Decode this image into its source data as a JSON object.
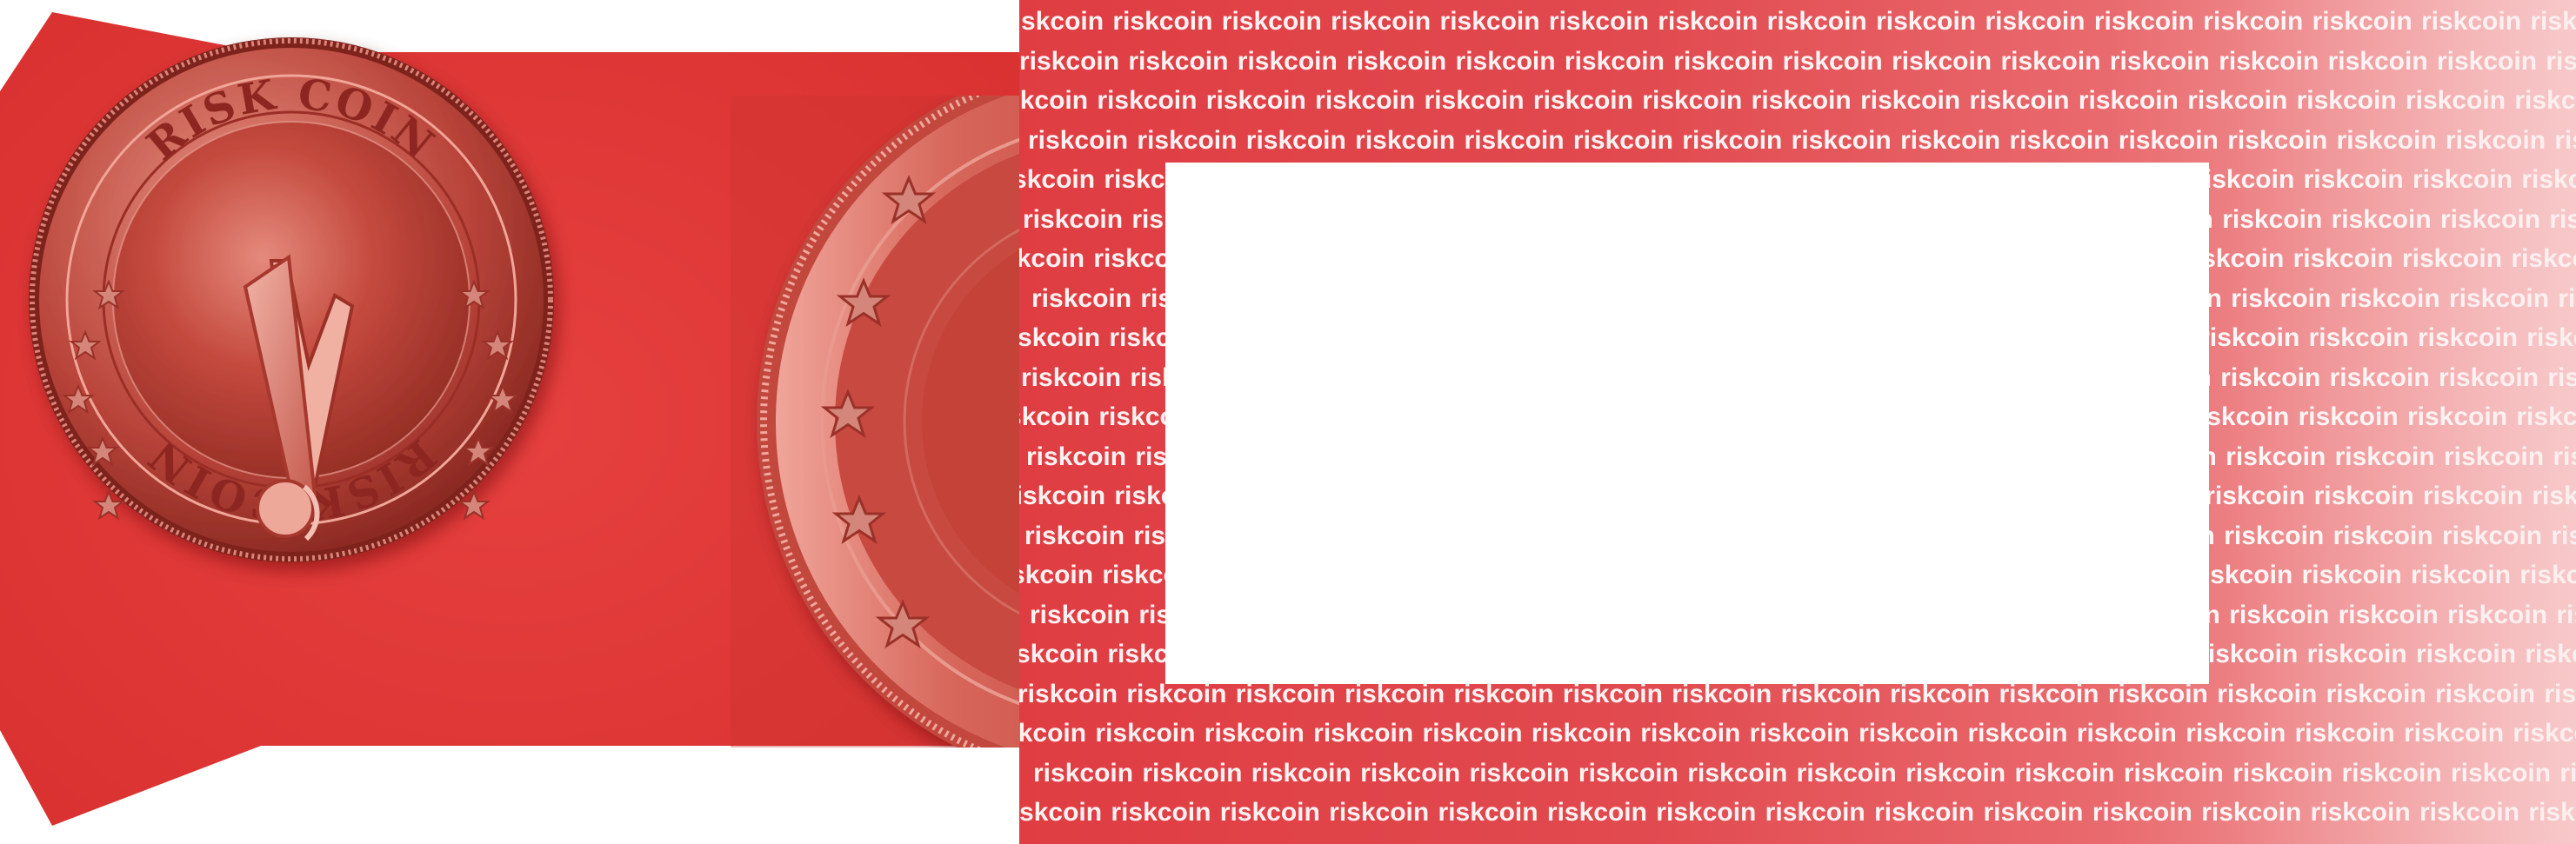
{
  "coin": {
    "top_text": "RISK COIN",
    "bottom_text": "RISK COIN",
    "symbol": "exclamation-mark"
  },
  "pattern": {
    "word": "riskcoin",
    "line_count": 21
  },
  "colors": {
    "envelope_red": "#e0393b",
    "coin_copper": "#c14a3f",
    "pattern_red": "#df3d42",
    "label_white": "#ffffff"
  }
}
